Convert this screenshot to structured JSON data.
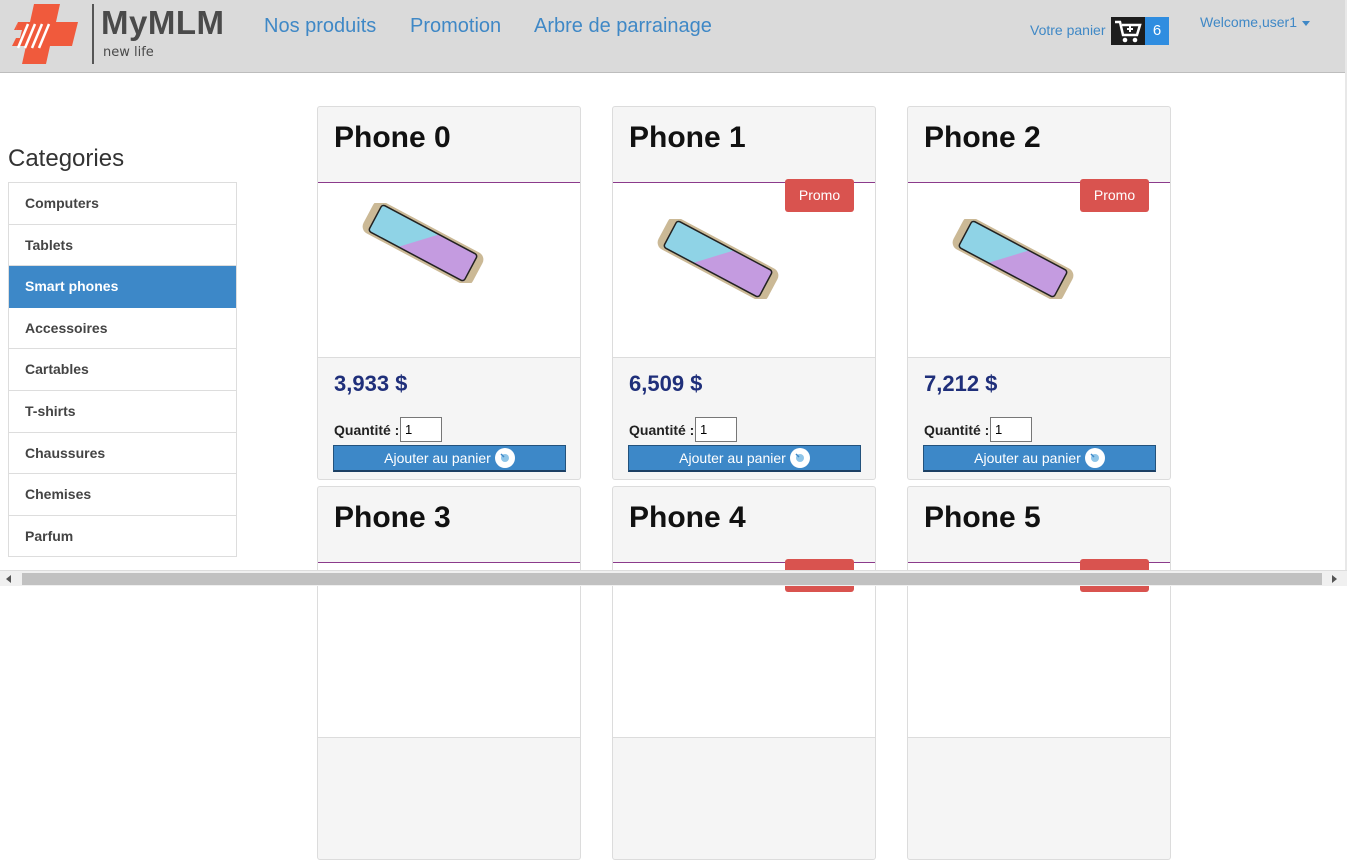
{
  "brand": {
    "name": "MyMLM",
    "tagline": "new life"
  },
  "nav": {
    "links": [
      "Nos produits",
      "Promotion",
      "Arbre de parrainage"
    ]
  },
  "cart": {
    "label": "Votre panier",
    "count": "6"
  },
  "user": {
    "welcome": "Welcome,user1"
  },
  "sidebar": {
    "title": "Categories",
    "items": [
      "Computers",
      "Tablets",
      "Smart phones",
      "Accessoires",
      "Cartables",
      "T-shirts",
      "Chaussures",
      "Chemises",
      "Parfum"
    ],
    "active": "Smart phones"
  },
  "products": [
    {
      "name": "Phone 0",
      "price": "3,933 $",
      "promo": "",
      "quantity": "1"
    },
    {
      "name": "Phone 1",
      "price": "6,509 $",
      "promo": "Promo",
      "quantity": "1"
    },
    {
      "name": "Phone 2",
      "price": "7,212 $",
      "promo": "Promo",
      "quantity": "1"
    },
    {
      "name": "Phone 3",
      "price": "",
      "promo": "",
      "quantity": ""
    },
    {
      "name": "Phone 4",
      "price": "",
      "promo": "Promo",
      "quantity": ""
    },
    {
      "name": "Phone 5",
      "price": "",
      "promo": "Promo",
      "quantity": ""
    }
  ],
  "labels": {
    "quantity": "Quantité :",
    "add_to_cart": "Ajouter au panier"
  },
  "colors": {
    "accent": "#3d88c8",
    "promo": "#d9534f",
    "price": "#1f2f7a",
    "logo_red": "#ef4b3a"
  }
}
